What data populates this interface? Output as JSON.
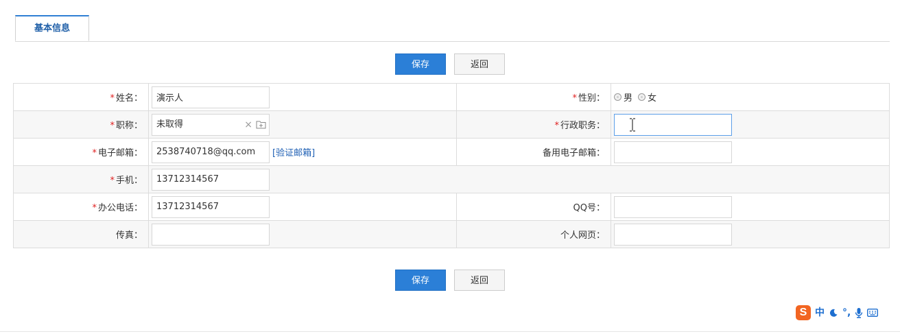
{
  "tabs": [
    {
      "label": "基本信息",
      "active": true
    }
  ],
  "buttons": {
    "save_label": "保存",
    "back_label": "返回"
  },
  "form": {
    "name": {
      "label": "姓名：",
      "required_mark": "*",
      "value": "演示人"
    },
    "gender": {
      "label": "性别：",
      "required_mark": "*",
      "options": [
        "男",
        "女"
      ]
    },
    "title": {
      "label": "职称：",
      "required_mark": "*",
      "value": "未取得",
      "clear_glyph": "×"
    },
    "admin_position": {
      "label": "行政职务：",
      "required_mark": "*",
      "value": ""
    },
    "email": {
      "label": "电子邮箱：",
      "required_mark": "*",
      "value": "2538740718@qq.com",
      "verify_link": "[验证邮箱]"
    },
    "backup_email": {
      "label": "备用电子邮箱：",
      "value": ""
    },
    "mobile": {
      "label": "手机：",
      "required_mark": "*",
      "value": "13712314567"
    },
    "office_phone": {
      "label": "办公电话：",
      "required_mark": "*",
      "value": "13712314567"
    },
    "qq": {
      "label": "QQ号：",
      "value": ""
    },
    "fax": {
      "label": "传真：",
      "value": ""
    },
    "homepage": {
      "label": "个人网页：",
      "value": ""
    }
  },
  "ime_toolbar": {
    "logo": "S",
    "mode": "中",
    "icons": [
      "moon-icon",
      "punctuation-icon",
      "microphone-icon",
      "keyboard-icon"
    ],
    "punct": "°,"
  },
  "colors": {
    "accent": "#2b7fd7",
    "required": "#e02020",
    "link": "#1e5fb4",
    "ime_brand": "#f26522"
  }
}
